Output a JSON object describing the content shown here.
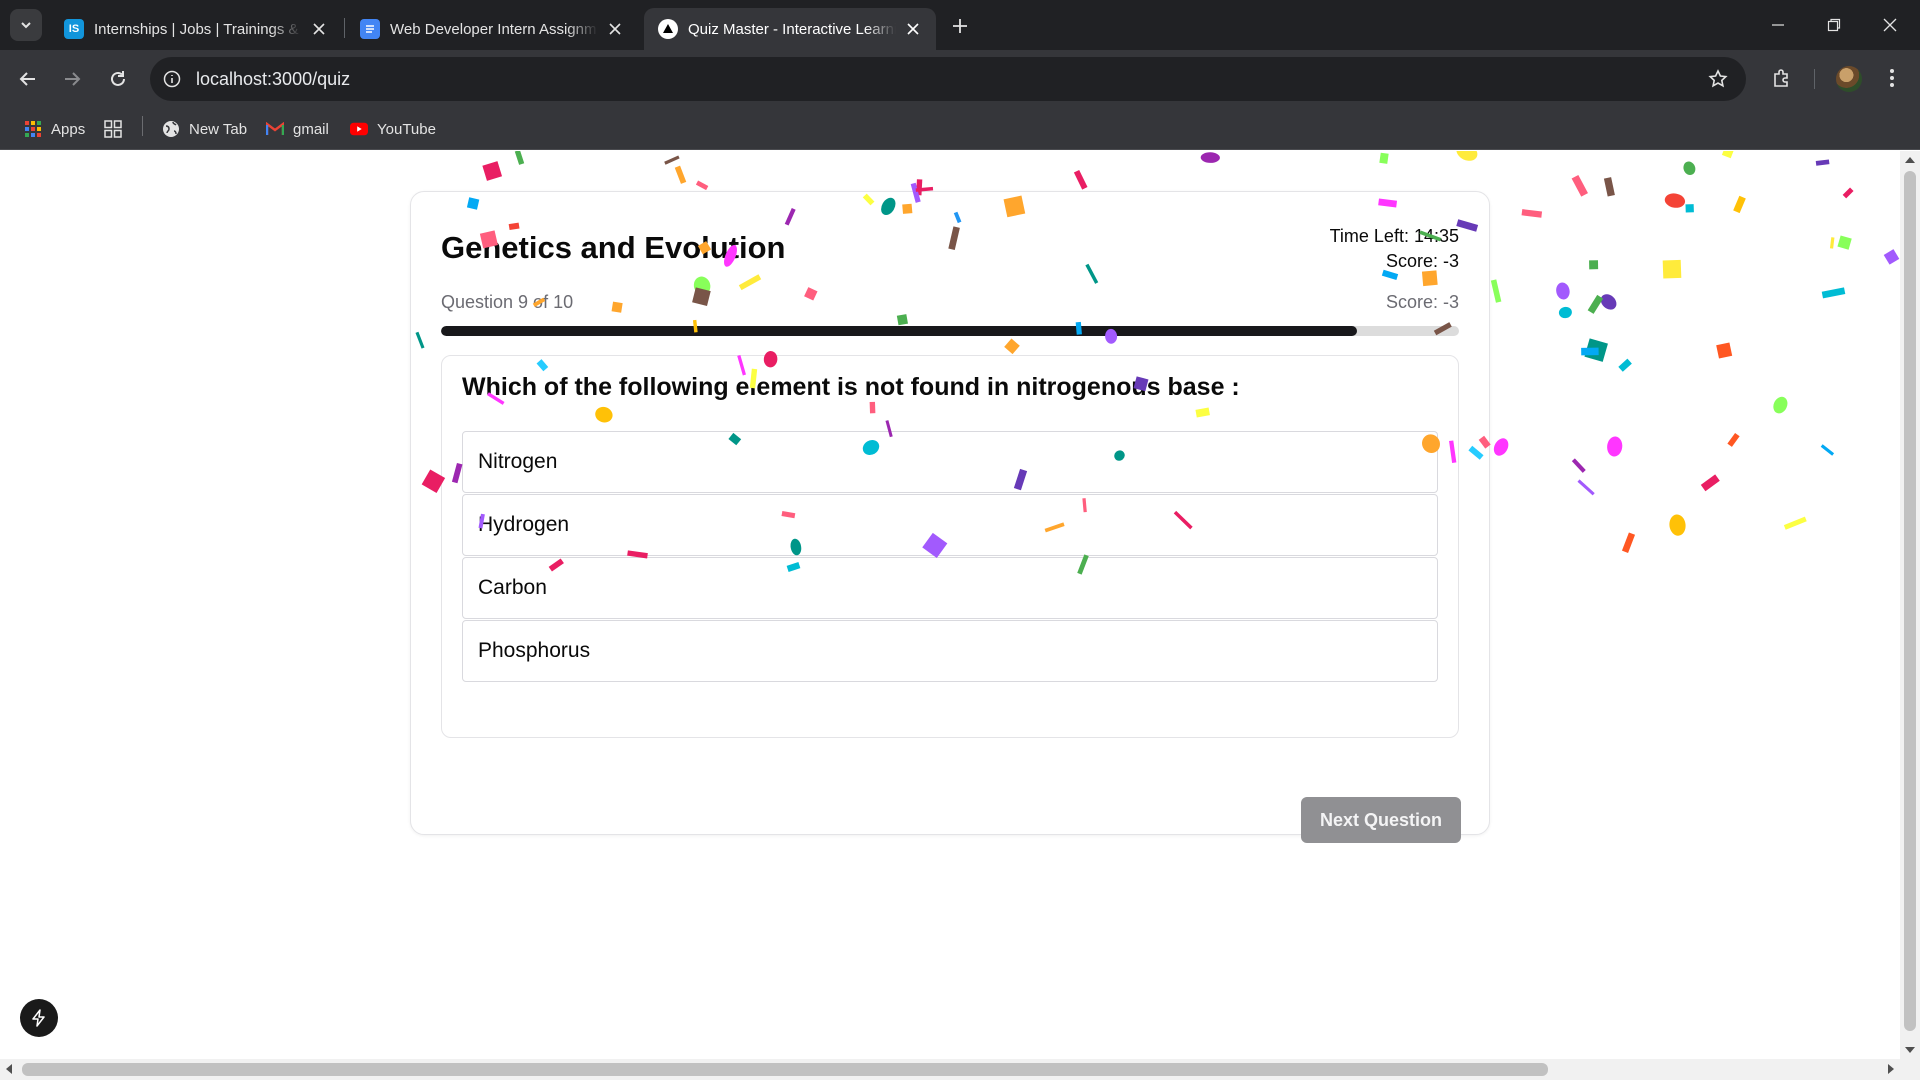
{
  "browser": {
    "tabs": [
      {
        "title": "Internships | Jobs | Trainings & I",
        "icon": "internshala-icon",
        "favicon_text": "IS",
        "favicon_color": "#1295db",
        "active": false
      },
      {
        "title": "Web Developer Intern Assignm",
        "icon": "google-docs-icon",
        "favicon_text": "",
        "favicon_color": "#4285f4",
        "active": false
      },
      {
        "title": "Quiz Master - Interactive Learni",
        "icon": "nextjs-icon",
        "favicon_text": "",
        "favicon_color": "#000000",
        "active": true
      }
    ],
    "url": "localhost:3000/quiz",
    "bookmarks": [
      {
        "label": "Apps",
        "icon": "apps-grid-icon"
      },
      {
        "label": "",
        "icon": "tab-groups-icon"
      },
      {
        "label": "New Tab",
        "icon": "globe-icon"
      },
      {
        "label": "gmail",
        "icon": "gmail-icon"
      },
      {
        "label": "YouTube",
        "icon": "youtube-icon"
      }
    ]
  },
  "quiz": {
    "title": "Genetics and Evolution",
    "time_left": "Time Left: 14:35",
    "score_top": "Score: -3",
    "question_counter": "Question 9 of 10",
    "score_right": "Score: -3",
    "progress_fraction": 0.9,
    "question": "Which of the following element is not found in nitrogenous base :",
    "options": [
      "Nitrogen",
      "Hydrogen",
      "Carbon",
      "Phosphorus"
    ],
    "next_label": "Next Question"
  },
  "colors": {
    "chrome_dark": "#202124",
    "chrome_toolbar": "#35363a",
    "progress_fill": "#18181b",
    "progress_track": "#dcdcdc",
    "next_button_disabled": "#909093",
    "confetti": [
      "#26ccff",
      "#a25afd",
      "#ff5e7e",
      "#88ff5a",
      "#fcff42",
      "#ffa62d",
      "#ff36ff",
      "#f44336",
      "#e91e63",
      "#9c27b0",
      "#673ab7",
      "#2196f3",
      "#03a9f4",
      "#00bcd4",
      "#009688",
      "#4caf50",
      "#ffeb3b",
      "#ffc107",
      "#ff5722",
      "#795548"
    ]
  }
}
